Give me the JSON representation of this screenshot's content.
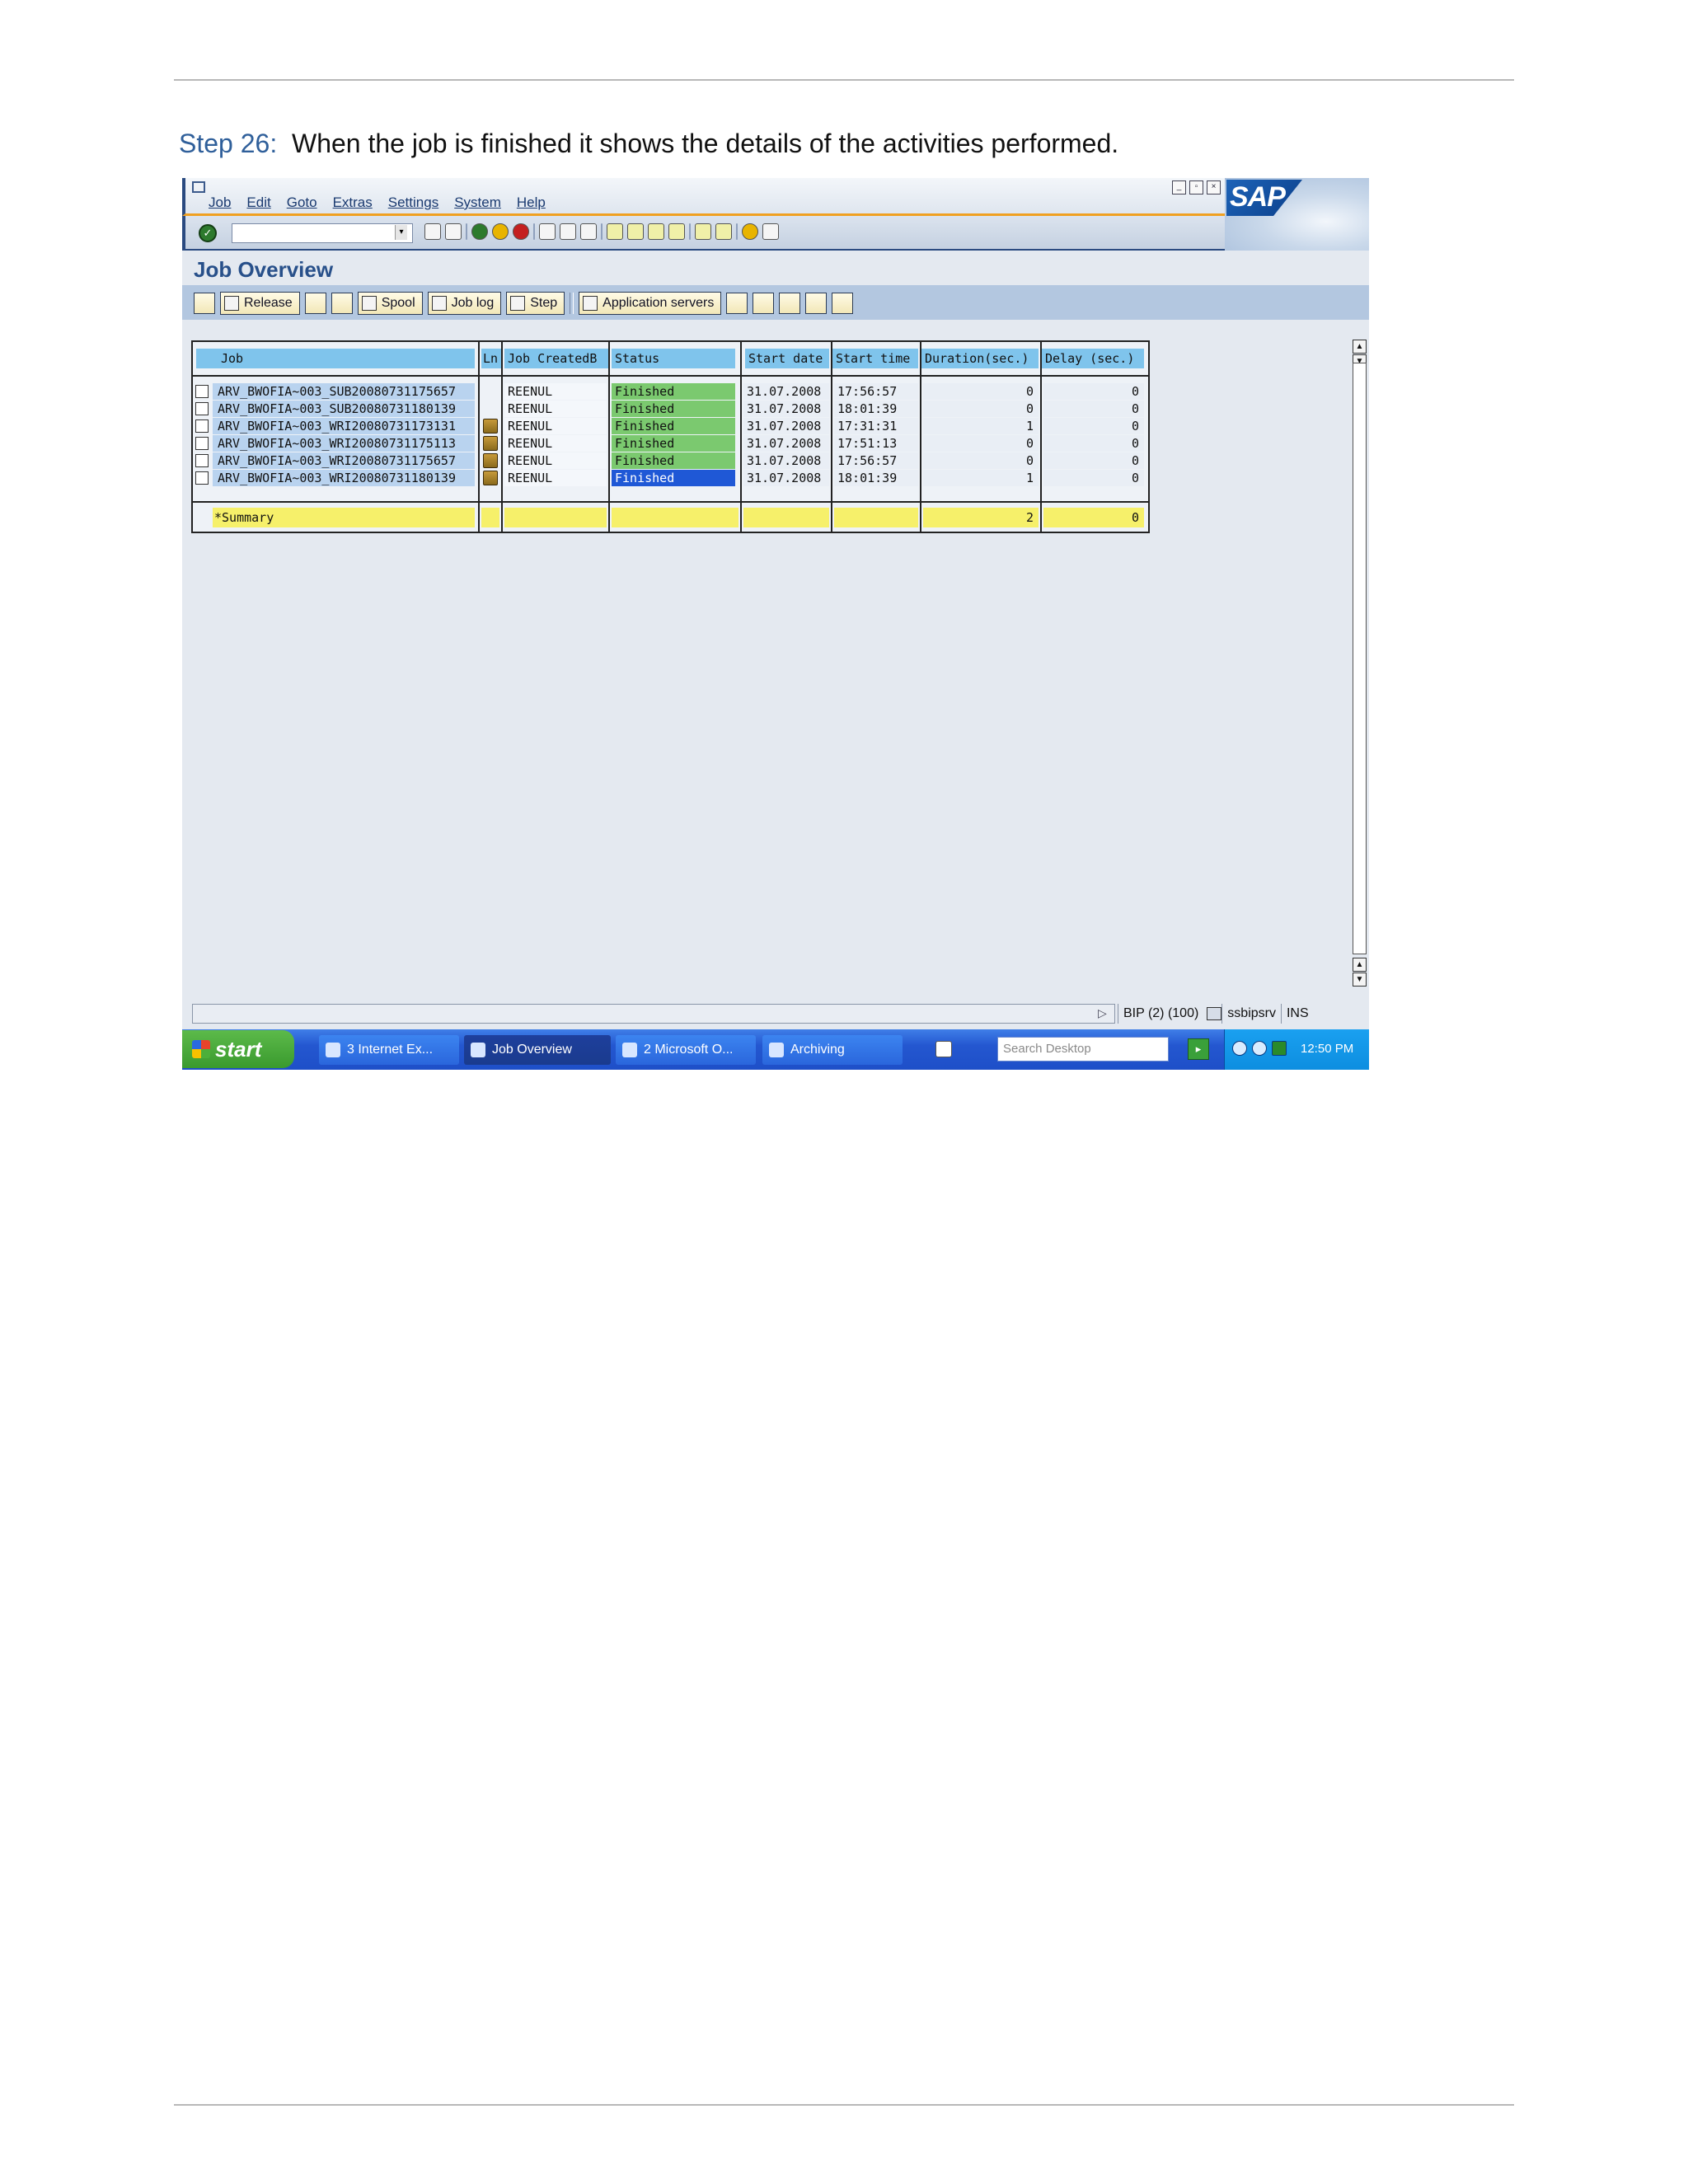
{
  "document": {
    "step_label": "Step 26:",
    "step_text": "When the job is finished it shows the details of the activities performed."
  },
  "sap": {
    "menu": [
      "Job",
      "Edit",
      "Goto",
      "Extras",
      "Settings",
      "System",
      "Help"
    ],
    "logo_text": "SAP",
    "title": "Job Overview",
    "app_toolbar": {
      "release": "Release",
      "spool": "Spool",
      "job_log": "Job log",
      "step": "Step",
      "app_servers": "Application servers"
    },
    "grid": {
      "columns": [
        "Job",
        "Ln",
        "Job CreatedB",
        "Status",
        "Start date",
        "Start time",
        "Duration(sec.)",
        "Delay (sec.)"
      ],
      "rows": [
        {
          "job": "ARV_BWOFIA~003_SUB20080731175657",
          "ln": false,
          "created_by": "REENUL",
          "status": "Finished",
          "start_date": "31.07.2008",
          "start_time": "17:56:57",
          "duration": "0",
          "delay": "0"
        },
        {
          "job": "ARV_BWOFIA~003_SUB20080731180139",
          "ln": false,
          "created_by": "REENUL",
          "status": "Finished",
          "start_date": "31.07.2008",
          "start_time": "18:01:39",
          "duration": "0",
          "delay": "0"
        },
        {
          "job": "ARV_BWOFIA~003_WRI20080731173131",
          "ln": true,
          "created_by": "REENUL",
          "status": "Finished",
          "start_date": "31.07.2008",
          "start_time": "17:31:31",
          "duration": "1",
          "delay": "0"
        },
        {
          "job": "ARV_BWOFIA~003_WRI20080731175113",
          "ln": true,
          "created_by": "REENUL",
          "status": "Finished",
          "start_date": "31.07.2008",
          "start_time": "17:51:13",
          "duration": "0",
          "delay": "0"
        },
        {
          "job": "ARV_BWOFIA~003_WRI20080731175657",
          "ln": true,
          "created_by": "REENUL",
          "status": "Finished",
          "start_date": "31.07.2008",
          "start_time": "17:56:57",
          "duration": "0",
          "delay": "0"
        },
        {
          "job": "ARV_BWOFIA~003_WRI20080731180139",
          "ln": true,
          "created_by": "REENUL",
          "status": "Finished",
          "start_date": "31.07.2008",
          "start_time": "18:01:39",
          "duration": "1",
          "delay": "0",
          "selected": true
        }
      ],
      "summary": {
        "label": "*Summary",
        "duration": "2",
        "delay": "0"
      }
    },
    "status_bar": {
      "system": "BIP (2) (100)",
      "server": "ssbipsrv",
      "mode": "INS"
    }
  },
  "taskbar": {
    "start": "start",
    "tasks": [
      "3 Internet Ex...",
      "Job Overview",
      "2 Microsoft O...",
      "Archiving"
    ],
    "search_placeholder": "Search Desktop",
    "clock": "12:50 PM"
  },
  "colors": {
    "status_finished": "#7bc96f",
    "header_cell": "#7fc4ec",
    "summary_row": "#f6f06a",
    "selected": "#1f58d6"
  }
}
